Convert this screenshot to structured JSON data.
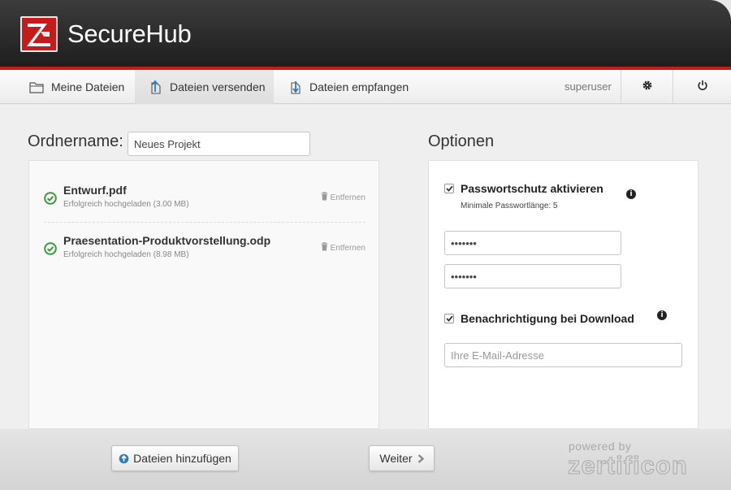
{
  "app": {
    "title": "SecureHub"
  },
  "colors": {
    "accent": "#c71b1b",
    "success": "#3a9a3a",
    "header_bg": "#2a2a2a"
  },
  "nav": {
    "tabs": [
      {
        "label": "Meine Dateien",
        "icon": "folder-icon",
        "active": false
      },
      {
        "label": "Dateien versenden",
        "icon": "upload-file-icon",
        "active": true
      },
      {
        "label": "Dateien empfangen",
        "icon": "download-file-icon",
        "active": false
      }
    ],
    "user": "superuser",
    "settings_icon": "gear-icon",
    "logout_icon": "power-icon"
  },
  "folder": {
    "label": "Ordnername:",
    "value": "Neues Projekt"
  },
  "files": [
    {
      "name": "Entwurf.pdf",
      "status": "Erfolgreich hochgeladen (3.00 MB)",
      "remove_label": "Entfernen"
    },
    {
      "name": "Praesentation-Produktvorstellung.odp",
      "status": "Erfolgreich hochgeladen (8.98 MB)",
      "remove_label": "Entfernen"
    }
  ],
  "options": {
    "title": "Optionen",
    "password_protection": {
      "label": "Passwortschutz aktivieren",
      "checked": true,
      "hint": "Minimale Passwortlänge: 5",
      "password": "•••••••",
      "password_confirm": "•••••••"
    },
    "notification": {
      "label": "Benachrichtigung bei Download",
      "checked": true,
      "email_placeholder": "Ihre E-Mail-Adresse"
    }
  },
  "footer": {
    "add_files_label": "Dateien hinzufügen",
    "next_label": "Weiter",
    "powered_by": "powered by",
    "vendor": "zertificon"
  }
}
